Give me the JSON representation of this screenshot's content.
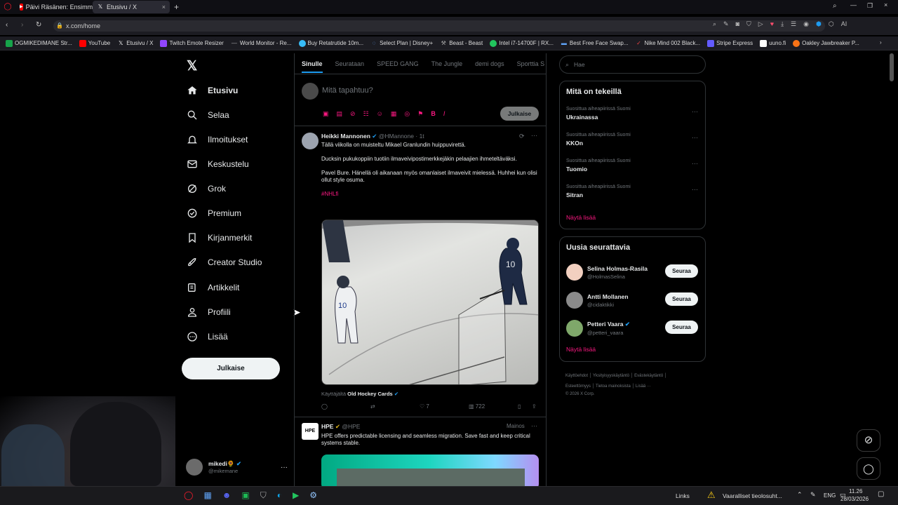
{
  "browser": {
    "tabs": [
      {
        "label": "Päivi Räsänen: Ensimmäis"
      },
      {
        "label": "Etusivu / X"
      }
    ],
    "url": "x.com/home",
    "bookmarks": [
      "OGMIKEDIMANE Str...",
      "YouTube",
      "Etusivu / X",
      "Twitch Emote Resizer",
      "World Monitor - Re...",
      "Buy Retatrutide 10m...",
      "Select Plan | Disney+",
      "Beast - Beast",
      "Intel i7-14700F | RX...",
      "Best Free Face Swap...",
      "Nike Mind 002 Black...",
      "Stripe Express",
      "uuno.fi",
      "Oakley Jawbreaker P..."
    ]
  },
  "nav": {
    "items": [
      {
        "label": "Etusivu"
      },
      {
        "label": "Selaa"
      },
      {
        "label": "Ilmoitukset"
      },
      {
        "label": "Keskustelu"
      },
      {
        "label": "Grok"
      },
      {
        "label": "Premium"
      },
      {
        "label": "Kirjanmerkit"
      },
      {
        "label": "Creator Studio"
      },
      {
        "label": "Artikkelit"
      },
      {
        "label": "Profiili"
      },
      {
        "label": "Lisää"
      }
    ],
    "post_button": "Julkaise",
    "account": {
      "name": "mikedi🌻",
      "handle": "@mikemane"
    }
  },
  "feed": {
    "tabs": [
      "Sinulle",
      "Seurataan",
      "SPEED GANG",
      "The Jungle",
      "demi dogs",
      "Sporttia S"
    ],
    "composer": {
      "placeholder": "Mitä tapahtuu?",
      "post": "Julkaise"
    },
    "tweet1": {
      "name": "Heikki Mannonen",
      "handle": "@HMannone",
      "time": "· 1t",
      "p1": "Tällä viikolla on muisteltu Mikael Granlundin huippuvirettä.",
      "p2": "Ducksin pukukoppiin tuotiin ilmaveivipostimerkkejäkin pelaajien ihmeteltäväksi.",
      "p3": "Pavel Bure. Hänellä oli aikanaan myös omanlaiset ilmaveivit mielessä. Huhhei kun olisi ollut style osuma.",
      "hashtag": "#NHLfi",
      "attribution_prefix": "Käyttäjältä",
      "attribution": "Old Hockey Cards",
      "likes": "7",
      "views": "722"
    },
    "tweet2": {
      "name": "HPE",
      "handle": "@HPE",
      "ad": "Mainos",
      "text": "HPE offers predictable licensing and seamless migration. Save fast and keep critical systems stable."
    }
  },
  "search": {
    "placeholder": "Hae"
  },
  "trends": {
    "title": "Mitä on tekeillä",
    "items": [
      {
        "ctx": "Suosittua aiheapiirissä Suomi",
        "name": "Ukrainassa"
      },
      {
        "ctx": "Suosittua aiheapiirissä Suomi",
        "name": "KKOn"
      },
      {
        "ctx": "Suosittua aiheapiirissä Suomi",
        "name": "Tuomio"
      },
      {
        "ctx": "Suosittua aiheapiirissä Suomi",
        "name": "Sitran"
      }
    ],
    "more": "Näytä lisää"
  },
  "who_to_follow": {
    "title": "Uusia seurattavia",
    "items": [
      {
        "name": "Selina Holmas-Rasila",
        "handle": "@HolmasSelina",
        "button": "Seuraa"
      },
      {
        "name": "Antti Mollanen",
        "handle": "@cidaktikki",
        "button": "Seuraa"
      },
      {
        "name": "Petteri Vaara",
        "handle": "@petteri_vaara",
        "button": "Seuraa"
      }
    ],
    "more": "Näytä lisää"
  },
  "footer": {
    "links": [
      "Käyttöehdot",
      "Yksityisyyskäytäntö",
      "Evästekäytäntö",
      "Esteettömyys",
      "Tietoa mainoksista",
      "Lisää ···"
    ],
    "copyright": "© 2026 X Corp."
  },
  "taskbar": {
    "links": "Links",
    "alert": "Vaaralliset tieolosuht...",
    "lang": "ENG",
    "time": "11.26",
    "date": "28/03/2026"
  },
  "colors": {
    "accent": "#1d9bf0",
    "hashtag": "#f91880",
    "bg": "#000000",
    "border": "#2f3336"
  }
}
